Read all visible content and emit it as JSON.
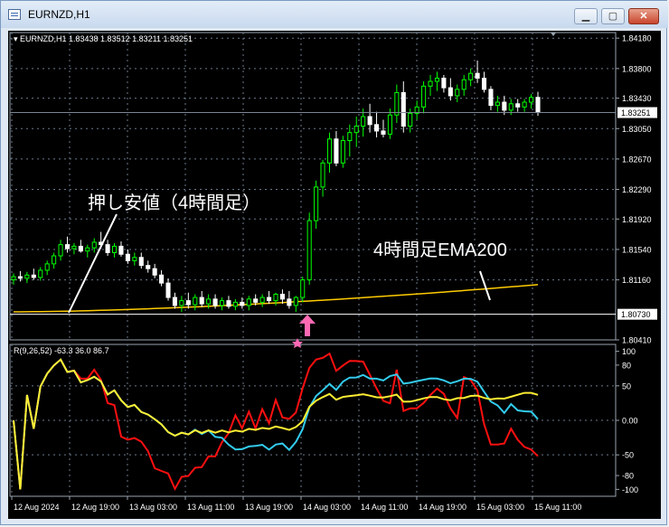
{
  "window": {
    "title": "EURNZD,H1",
    "buttons": [
      "minimize",
      "maximize",
      "close"
    ]
  },
  "chart_header": "EURNZD,H1  1.83438 1.83512 1.83211 1.83251",
  "price_axis": [
    "1.84180",
    "1.83800",
    "1.83430",
    "1.83050",
    "1.82670",
    "1.82290",
    "1.81920",
    "1.81540",
    "1.81160",
    "1.80410"
  ],
  "price_tags": {
    "current": "1.83251",
    "level": "1.80730"
  },
  "annotations": {
    "pullback": "押し安値（4時間足）",
    "ema": "4時間足EMA200"
  },
  "indicator": {
    "label": "R(9,26,52) -63.3 36.0 86.7",
    "axis": [
      "100",
      "80",
      "50",
      "0.00",
      "-50",
      "-80",
      "-100"
    ]
  },
  "time_axis": [
    "12 Aug 2024",
    "12 Aug 19:00",
    "13 Aug 03:00",
    "13 Aug 11:00",
    "13 Aug 19:00",
    "14 Aug 03:00",
    "14 Aug 11:00",
    "14 Aug 19:00",
    "15 Aug 03:00",
    "15 Aug 11:00"
  ],
  "colors": {
    "bull": "#00ff00",
    "bear": "#ffffff",
    "ema": "#ffcc00",
    "level_line": "#ffffff",
    "rsi_fast": "#ff1010",
    "rsi_mid": "#33ccee",
    "rsi_slow": "#ffee33",
    "arrow": "#ff69b4",
    "grid": "#6b7a8c"
  },
  "chart_data": {
    "type": "candlestick",
    "symbol": "EURNZD",
    "timeframe": "H1",
    "ylim": [
      1.8041,
      1.8425
    ],
    "candles": [
      [
        1.8116,
        1.8124,
        1.811,
        1.812
      ],
      [
        1.812,
        1.8127,
        1.8114,
        1.8118
      ],
      [
        1.8118,
        1.8126,
        1.8112,
        1.8122
      ],
      [
        1.8122,
        1.813,
        1.8116,
        1.8119
      ],
      [
        1.8119,
        1.8132,
        1.8115,
        1.8128
      ],
      [
        1.8128,
        1.814,
        1.8122,
        1.8136
      ],
      [
        1.8136,
        1.815,
        1.813,
        1.8146
      ],
      [
        1.8146,
        1.8166,
        1.814,
        1.816
      ],
      [
        1.816,
        1.817,
        1.815,
        1.8155
      ],
      [
        1.8155,
        1.8162,
        1.8148,
        1.8158
      ],
      [
        1.8158,
        1.8166,
        1.815,
        1.8152
      ],
      [
        1.8152,
        1.816,
        1.8144,
        1.8156
      ],
      [
        1.8156,
        1.8168,
        1.815,
        1.8163
      ],
      [
        1.8163,
        1.8176,
        1.8155,
        1.816
      ],
      [
        1.816,
        1.8166,
        1.8146,
        1.815
      ],
      [
        1.815,
        1.8162,
        1.8144,
        1.8158
      ],
      [
        1.8158,
        1.8164,
        1.8145,
        1.8148
      ],
      [
        1.8148,
        1.8154,
        1.8136,
        1.814
      ],
      [
        1.814,
        1.815,
        1.8134,
        1.8144
      ],
      [
        1.8144,
        1.815,
        1.813,
        1.8134
      ],
      [
        1.8134,
        1.814,
        1.8125,
        1.813
      ],
      [
        1.813,
        1.8136,
        1.8118,
        1.8122
      ],
      [
        1.8122,
        1.8128,
        1.8108,
        1.8112
      ],
      [
        1.8112,
        1.8118,
        1.809,
        1.8094
      ],
      [
        1.8094,
        1.81,
        1.808,
        1.8084
      ],
      [
        1.8084,
        1.8096,
        1.8076,
        1.809
      ],
      [
        1.809,
        1.81,
        1.808,
        1.8085
      ],
      [
        1.8085,
        1.8098,
        1.8078,
        1.8094
      ],
      [
        1.8094,
        1.8102,
        1.8082,
        1.8086
      ],
      [
        1.8086,
        1.8098,
        1.808,
        1.8092
      ],
      [
        1.8092,
        1.8098,
        1.808,
        1.8084
      ],
      [
        1.8084,
        1.8094,
        1.8078,
        1.809
      ],
      [
        1.809,
        1.8096,
        1.808,
        1.8083
      ],
      [
        1.8083,
        1.8092,
        1.8078,
        1.8088
      ],
      [
        1.8088,
        1.8094,
        1.808,
        1.8084
      ],
      [
        1.8084,
        1.8096,
        1.8078,
        1.8092
      ],
      [
        1.8092,
        1.8098,
        1.8084,
        1.8088
      ],
      [
        1.8088,
        1.8098,
        1.8082,
        1.8094
      ],
      [
        1.8094,
        1.8102,
        1.8086,
        1.809
      ],
      [
        1.809,
        1.81,
        1.8084,
        1.8098
      ],
      [
        1.8098,
        1.8104,
        1.8086,
        1.8092
      ],
      [
        1.8092,
        1.8102,
        1.808,
        1.8084
      ],
      [
        1.8084,
        1.8096,
        1.8076,
        1.8094
      ],
      [
        1.8094,
        1.812,
        1.8088,
        1.8116
      ],
      [
        1.8116,
        1.82,
        1.811,
        1.819
      ],
      [
        1.819,
        1.824,
        1.818,
        1.8232
      ],
      [
        1.8232,
        1.8266,
        1.822,
        1.8262
      ],
      [
        1.8262,
        1.83,
        1.825,
        1.8292
      ],
      [
        1.8292,
        1.8302,
        1.8258,
        1.8262
      ],
      [
        1.8262,
        1.8296,
        1.8256,
        1.829
      ],
      [
        1.829,
        1.831,
        1.827,
        1.83
      ],
      [
        1.83,
        1.832,
        1.8282,
        1.8308
      ],
      [
        1.8308,
        1.833,
        1.8295,
        1.832
      ],
      [
        1.832,
        1.8336,
        1.83,
        1.831
      ],
      [
        1.831,
        1.8326,
        1.8294,
        1.8302
      ],
      [
        1.8302,
        1.8316,
        1.8294,
        1.8298
      ],
      [
        1.8298,
        1.833,
        1.8292,
        1.8322
      ],
      [
        1.8322,
        1.836,
        1.8312,
        1.835
      ],
      [
        1.835,
        1.8364,
        1.83,
        1.8308
      ],
      [
        1.8308,
        1.833,
        1.83,
        1.8324
      ],
      [
        1.8324,
        1.834,
        1.8316,
        1.8332
      ],
      [
        1.8332,
        1.8364,
        1.8324,
        1.8358
      ],
      [
        1.8358,
        1.8372,
        1.8346,
        1.8364
      ],
      [
        1.8364,
        1.8376,
        1.8352,
        1.8368
      ],
      [
        1.8368,
        1.8372,
        1.835,
        1.8356
      ],
      [
        1.8356,
        1.8368,
        1.834,
        1.8346
      ],
      [
        1.8346,
        1.836,
        1.8338,
        1.8354
      ],
      [
        1.8354,
        1.8372,
        1.8346,
        1.8366
      ],
      [
        1.8366,
        1.838,
        1.8358,
        1.8374
      ],
      [
        1.8374,
        1.839,
        1.8362,
        1.8368
      ],
      [
        1.8368,
        1.8376,
        1.835,
        1.8354
      ],
      [
        1.8354,
        1.8358,
        1.8328,
        1.8334
      ],
      [
        1.8334,
        1.8346,
        1.8326,
        1.8338
      ],
      [
        1.8338,
        1.8346,
        1.8322,
        1.8328
      ],
      [
        1.8328,
        1.8342,
        1.8322,
        1.8336
      ],
      [
        1.8336,
        1.8342,
        1.8326,
        1.8332
      ],
      [
        1.8332,
        1.8342,
        1.8326,
        1.8338
      ],
      [
        1.8338,
        1.8348,
        1.833,
        1.8344
      ],
      [
        1.8344,
        1.8351,
        1.8321,
        1.8325
      ]
    ],
    "ema200": {
      "start": 1.8076,
      "end": 1.811
    },
    "pullback_low": 1.8073,
    "rsi": {
      "labels": [
        "R(9)",
        "R(26)",
        "R(52)"
      ],
      "ylim": [
        -110,
        110
      ],
      "levels": [
        100,
        80,
        50,
        0,
        -50,
        -80,
        -100
      ]
    }
  }
}
